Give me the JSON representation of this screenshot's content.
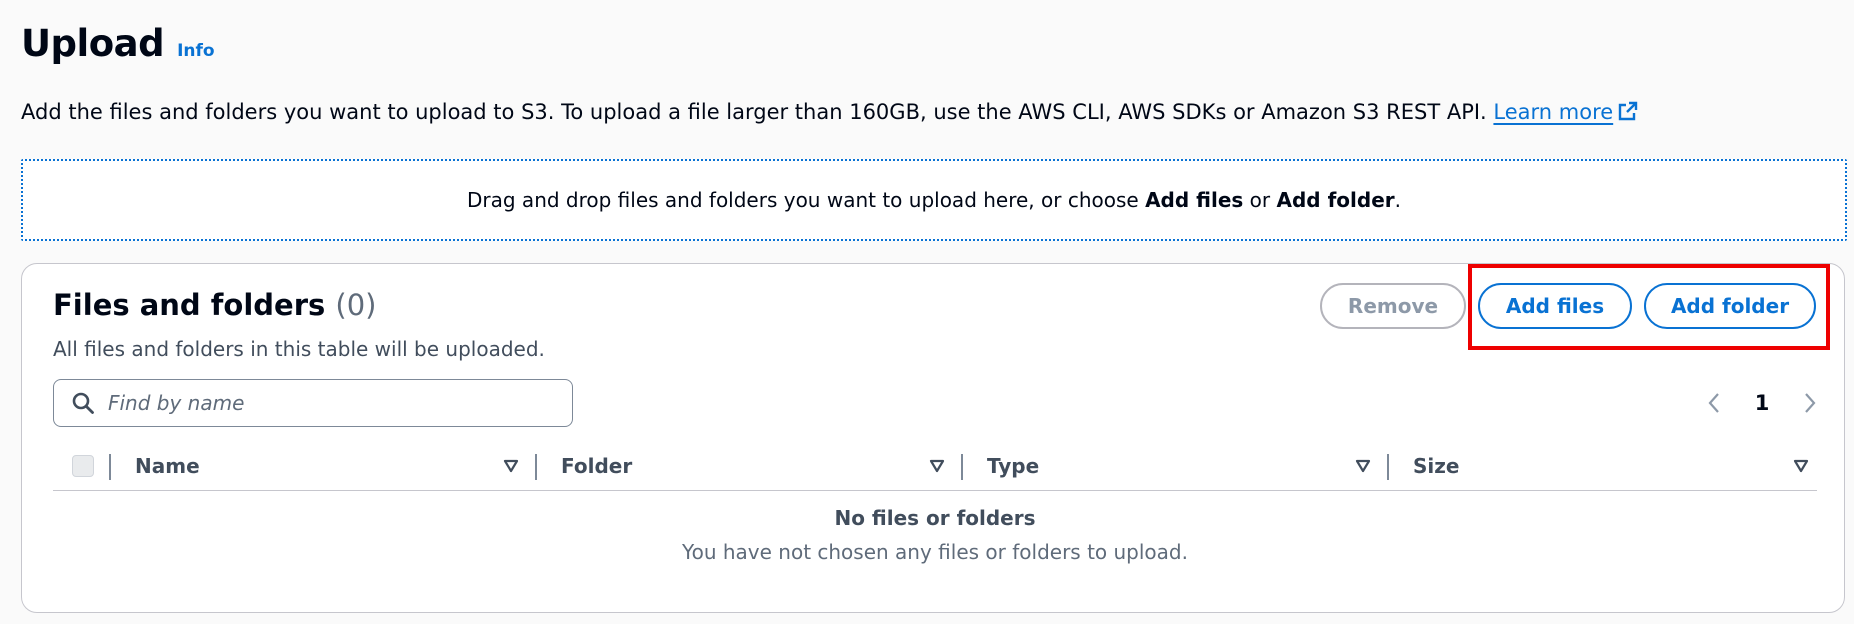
{
  "header": {
    "title": "Upload",
    "info_label": "Info"
  },
  "description": {
    "text": "Add the files and folders you want to upload to S3. To upload a file larger than 160GB, use the AWS CLI, AWS SDKs or Amazon S3 REST API. ",
    "learn_more_label": "Learn more"
  },
  "dropzone": {
    "text_before": "Drag and drop files and folders you want to upload here, or choose ",
    "add_files_bold": "Add files",
    "text_or": " or ",
    "add_folder_bold": "Add folder",
    "text_after": "."
  },
  "panel": {
    "title": "Files and folders",
    "count": "(0)",
    "subtitle": "All files and folders in this table will be uploaded.",
    "buttons": {
      "remove": "Remove",
      "add_files": "Add files",
      "add_folder": "Add folder"
    },
    "search": {
      "placeholder": "Find by name",
      "value": ""
    },
    "pagination": {
      "current_page": "1"
    },
    "table": {
      "columns": [
        "Name",
        "Folder",
        "Type",
        "Size"
      ]
    },
    "empty_state": {
      "title": "No files or folders",
      "description": "You have not chosen any files or folders to upload."
    }
  },
  "colors": {
    "accent": "#0972d3",
    "highlight": "#ee0000",
    "disabled": "#8d99a8",
    "border": "#c6c6cd"
  },
  "icons": {
    "external_link": "external-link-icon",
    "search": "search-icon",
    "sort": "sort-caret-icon",
    "prev": "chevron-left-icon",
    "next": "chevron-right-icon"
  }
}
